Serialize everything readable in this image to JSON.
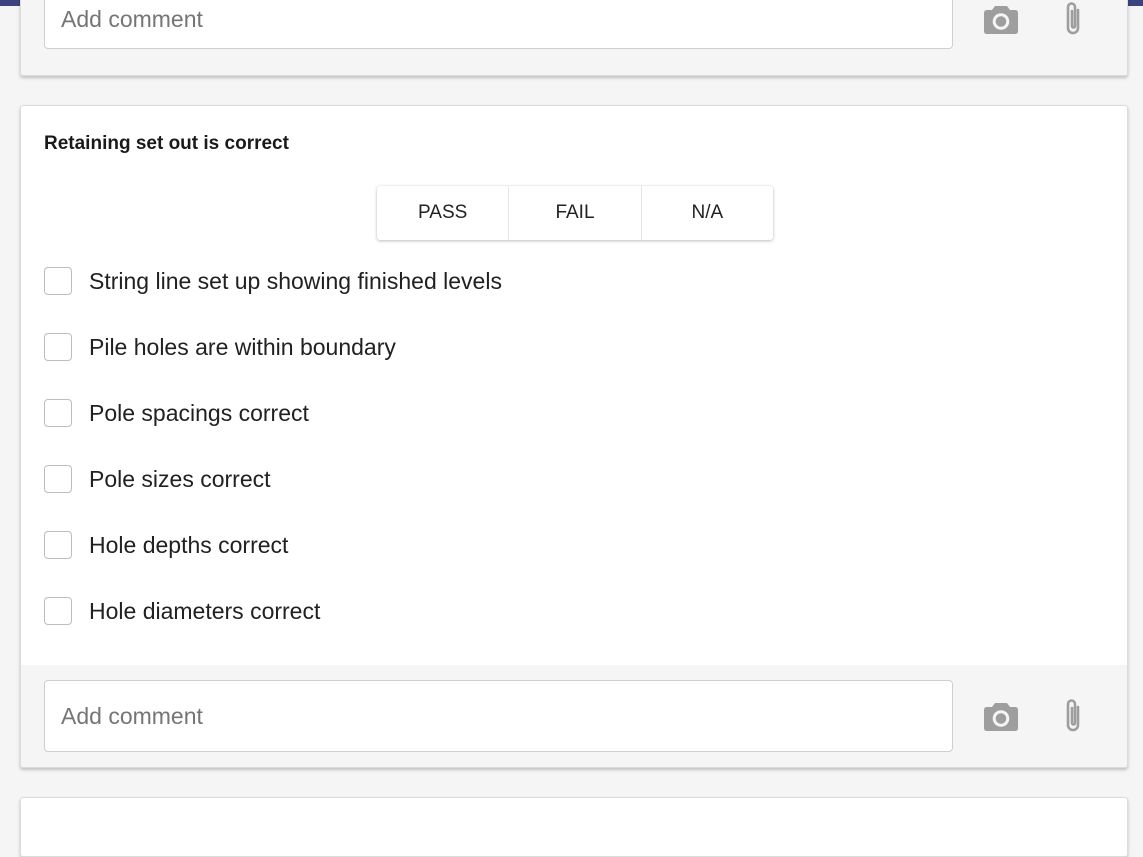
{
  "comment": {
    "placeholder": "Add comment"
  },
  "question": {
    "title": "Retaining set out is correct",
    "options": [
      "PASS",
      "FAIL",
      "N/A"
    ],
    "checklist": [
      "String line set up showing finished levels",
      "Pile holes are within boundary",
      "Pole spacings correct",
      "Pole sizes correct",
      "Hole depths correct",
      "Hole diameters correct"
    ]
  },
  "icons": {
    "camera": "camera-icon",
    "attach": "paperclip-icon"
  },
  "colors": {
    "top_bar": "#3b4480",
    "page_background": "#f5f5f5",
    "icon_gray": "#9e9e9e"
  }
}
